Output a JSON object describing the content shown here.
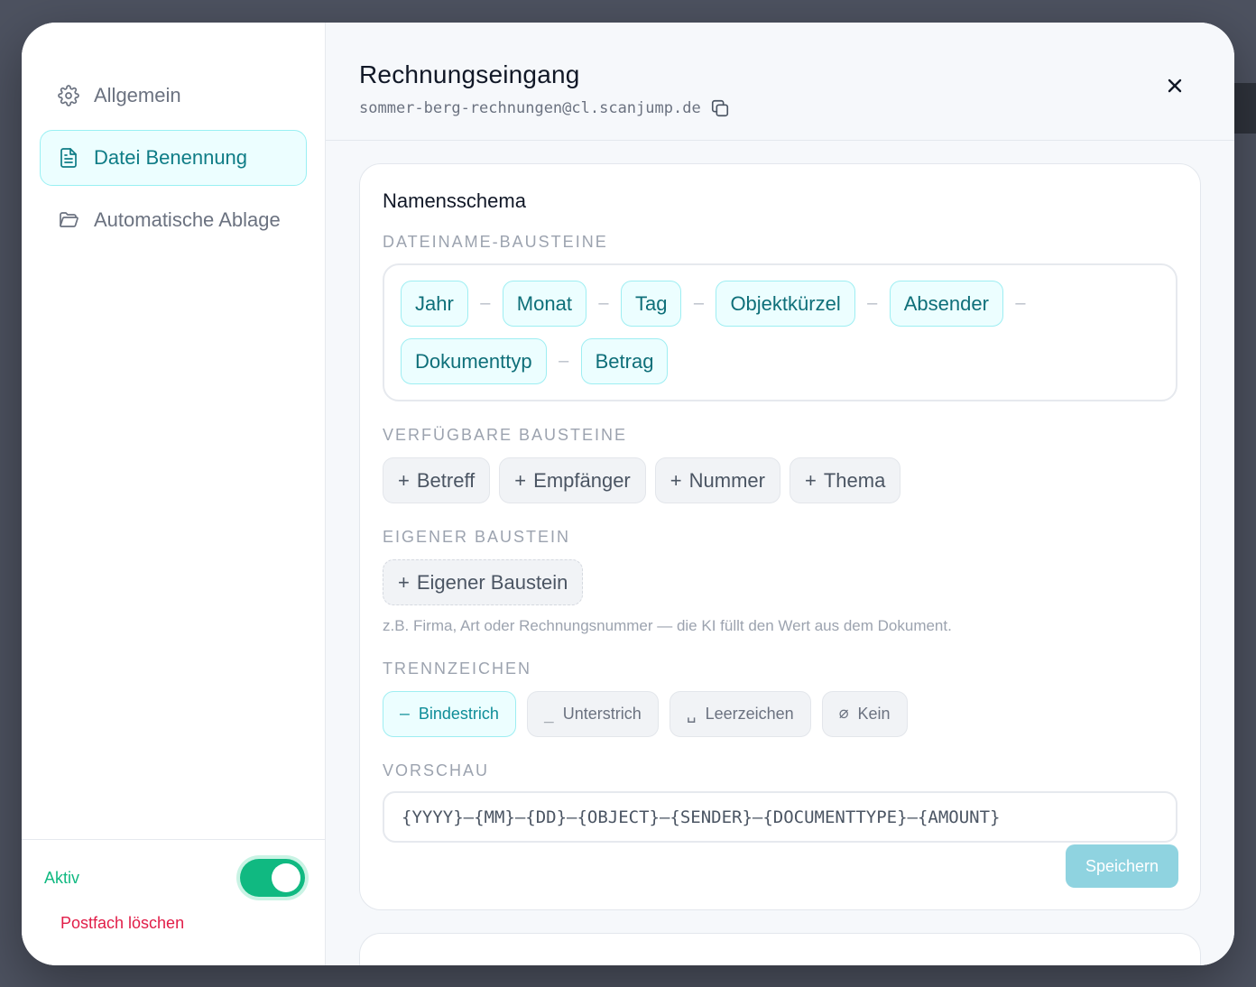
{
  "sidebar": {
    "items": [
      {
        "label": "Allgemein",
        "icon": "gear-icon"
      },
      {
        "label": "Datei Benennung",
        "icon": "document-icon",
        "active": true
      },
      {
        "label": "Automatische Ablage",
        "icon": "folder-icon"
      }
    ],
    "aktiv_label": "Aktiv",
    "aktiv_enabled": true,
    "delete_label": "Postfach löschen"
  },
  "header": {
    "title": "Rechnungseingang",
    "email": "sommer-berg-rechnungen@cl.scanjump.de"
  },
  "naming": {
    "card_title": "Namensschema",
    "label_building_blocks": "DATEINAME-BAUSTEINE",
    "blocks": [
      "Jahr",
      "Monat",
      "Tag",
      "Objektkürzel",
      "Absender",
      "Dokumenttyp",
      "Betrag"
    ],
    "separator_glyph": "–",
    "label_available": "VERFÜGBARE BAUSTEINE",
    "available": [
      "Betreff",
      "Empfänger",
      "Nummer",
      "Thema"
    ],
    "plus_glyph": "+",
    "label_custom": "EIGENER BAUSTEIN",
    "custom_button": "Eigener Baustein",
    "custom_hint": "z.B. Firma, Art oder Rechnungsnummer — die KI füllt den Wert aus dem Dokument.",
    "label_separator": "TRENNZEICHEN",
    "separators": [
      {
        "symbol": "–",
        "label": "Bindestrich",
        "active": true
      },
      {
        "symbol": "_",
        "label": "Unterstrich",
        "active": false
      },
      {
        "symbol": "␣",
        "label": "Leerzeichen",
        "active": false
      },
      {
        "symbol": "⌀",
        "label": "Kein",
        "active": false
      }
    ],
    "label_preview": "VORSCHAU",
    "preview": "{YYYY}–{MM}–{DD}–{OBJECT}–{SENDER}–{DOCUMENTTYPE}–{AMOUNT}",
    "save_label": "Speichern"
  },
  "colors": {
    "accent": "#0e7c86",
    "active_toggle": "#10b981",
    "danger": "#e11d48",
    "save_disabled": "#8fd3e0"
  }
}
